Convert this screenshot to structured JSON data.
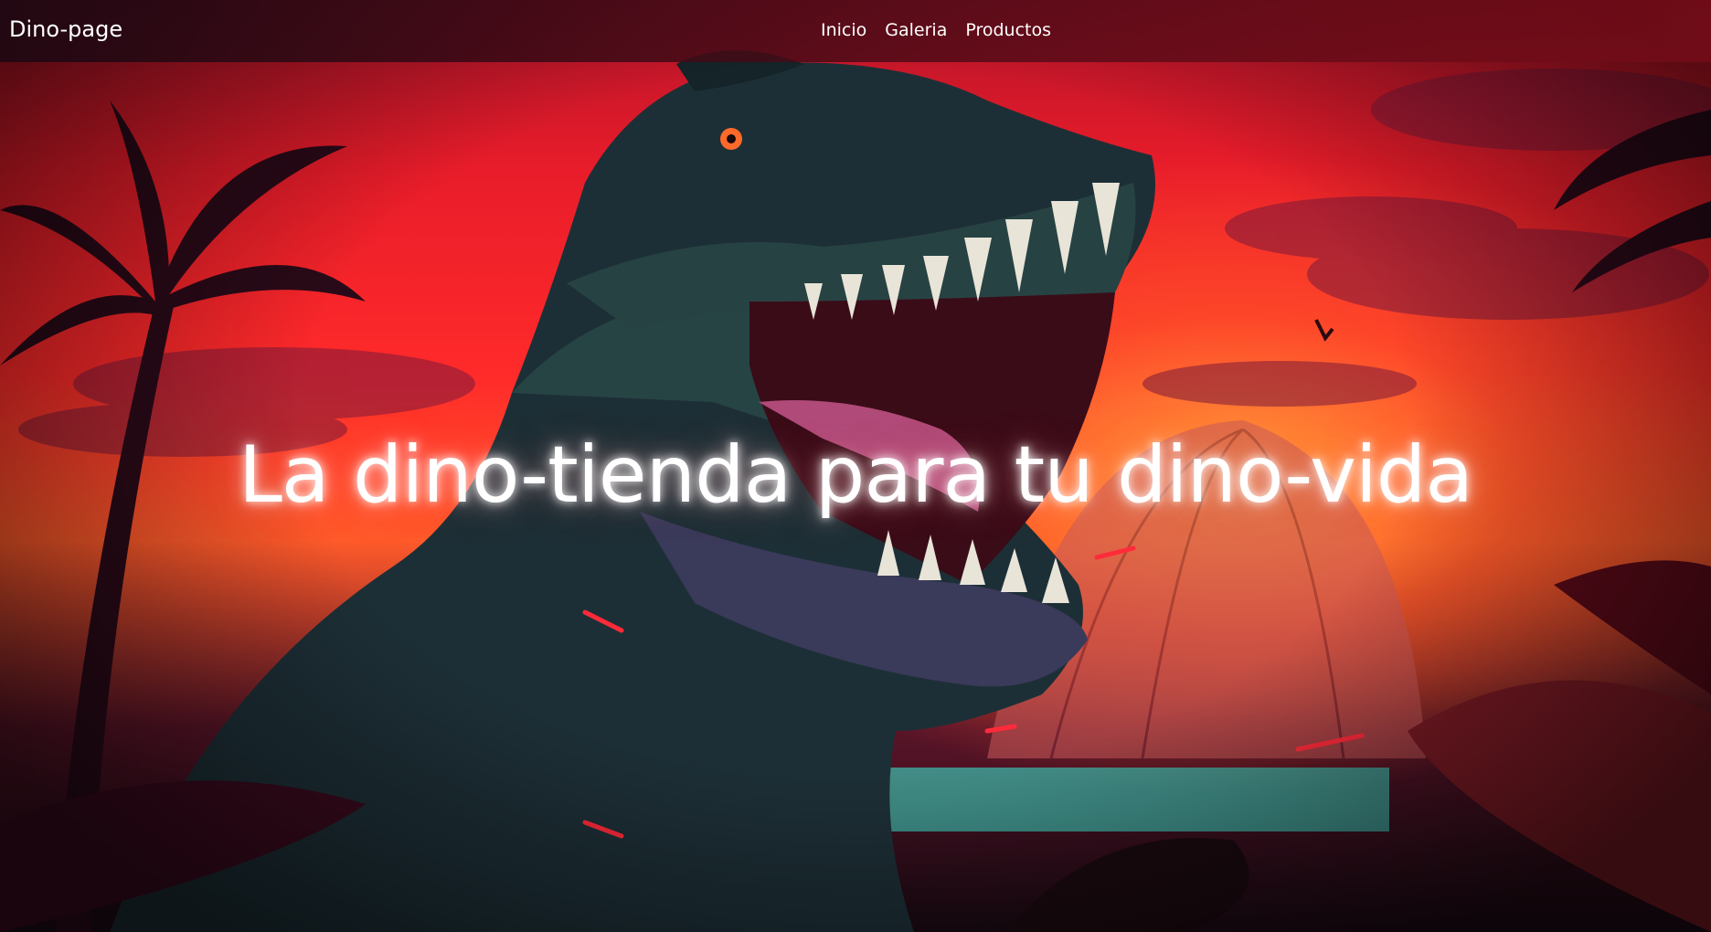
{
  "navbar": {
    "brand": "Dino-page",
    "links": [
      {
        "label": "Inicio"
      },
      {
        "label": "Galeria"
      },
      {
        "label": "Productos"
      }
    ]
  },
  "hero": {
    "title": "La dino-tienda para tu dino-vida",
    "image": "t-rex-jungle-sunset-illustration"
  },
  "colors": {
    "sky_red": "#ff2a2a",
    "sunset_orange": "#ff9a3a",
    "dino_teal": "#1f4a48",
    "navbar_bg": "#2a0a14",
    "text": "#ffffff"
  }
}
